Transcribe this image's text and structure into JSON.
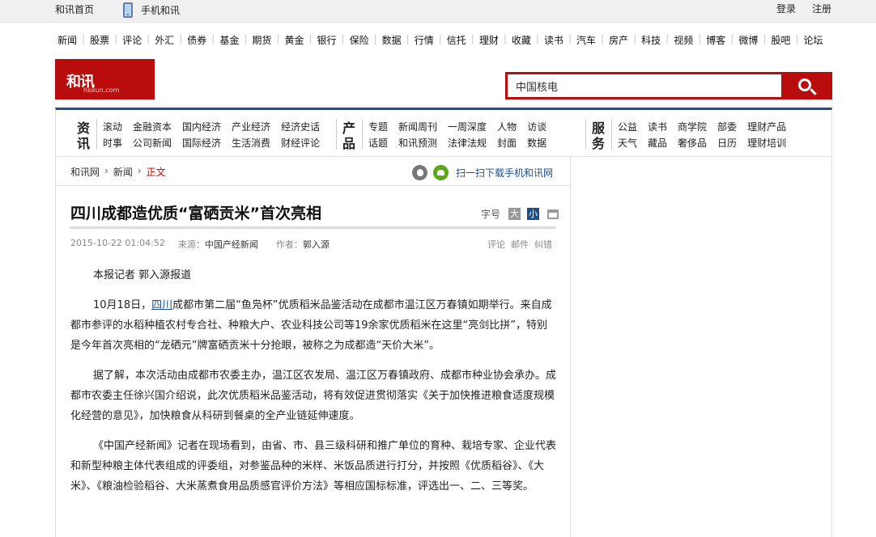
{
  "topbar": {
    "home": "和讯首页",
    "mobile": "手机和讯",
    "login": "登录",
    "register": "注册"
  },
  "channels": [
    "新闻",
    "股票",
    "评论",
    "外汇",
    "债券",
    "基金",
    "期货",
    "黄金",
    "银行",
    "保险",
    "数据",
    "行情",
    "信托",
    "理财",
    "收藏",
    "读书",
    "汽车",
    "房产",
    "科技",
    "视频",
    "博客",
    "微博",
    "股吧",
    "论坛"
  ],
  "logo": {
    "text": "和讯",
    "sub": "hexun.com"
  },
  "search": {
    "value": "中国核电"
  },
  "categories": {
    "news": {
      "title": [
        "资",
        "讯"
      ],
      "row1": [
        "滚动",
        "金融资本",
        "国内经济",
        "产业经济",
        "经济史话"
      ],
      "row2": [
        "时事",
        "公司新闻",
        "国际经济",
        "生活消费",
        "财经评论"
      ]
    },
    "products": {
      "title": [
        "产",
        "品"
      ],
      "row1": [
        "专题",
        "新闻周刊",
        "一周深度",
        "人物",
        "访谈"
      ],
      "row2": [
        "话题",
        "和讯预测",
        "法律法规",
        "封面",
        "数据"
      ]
    },
    "services": {
      "title": [
        "服",
        "务"
      ],
      "row1": [
        "公益",
        "读书",
        "商学院",
        "部委",
        "理财产品"
      ],
      "row2": [
        "天气",
        "藏品",
        "奢侈品",
        "日历",
        "理财培训"
      ]
    }
  },
  "breadcrumb": {
    "site": "和讯网",
    "section": "新闻",
    "current": "正文"
  },
  "download": {
    "text": "扫一扫下载手机和讯网"
  },
  "article": {
    "title": "四川成都造优质“富硒贡米”首次亮相",
    "fontsize_label": "字号",
    "big": "大",
    "small": "小",
    "date": "2015-10-22 01:04:52",
    "source_label": "来源：",
    "source": "中国产经新闻",
    "author_label": "作者：",
    "author": "郭入源",
    "links": [
      "评论",
      "邮件",
      "纠错"
    ],
    "p1": "本报记者  郭入源报道",
    "p2_pre": "10月18日，",
    "p2_kw": "四川",
    "p2_post": "成都市第二届“鱼凫杯”优质稻米品鉴活动在成都市温江区万春镇如期举行。来自成都市参评的水稻种植农村专合社、种粮大户、农业科技公司等19余家优质稻米在这里“亮剑比拼”，特别是今年首次亮相的“龙硒元”牌富硒贡米十分抢眼，被称之为成都造“天价大米”。",
    "p3": "据了解，本次活动由成都市农委主办，温江区农发局、温江区万春镇政府、成都市种业协会承办。成都市农委主任徐兴国介绍说，此次优质稻米品鉴活动，将有效促进贯彻落实《关于加快推进粮食适度规模化经营的意见》，加快粮食从科研到餐桌的全产业链延伸速度。",
    "p4": "《中国产经新闻》记者在现场看到，由省、市、县三级科研和推广单位的育种、栽培专家、企业代表和新型种粮主体代表组成的评委组，对参鉴品种的米样、米饭品质进行打分，并按照《优质稻谷》、《大米》、《粮油检验稻谷、大米蒸煮食用品质感官评价方法》等相应国标标准，评选出一、二、三等奖。"
  }
}
